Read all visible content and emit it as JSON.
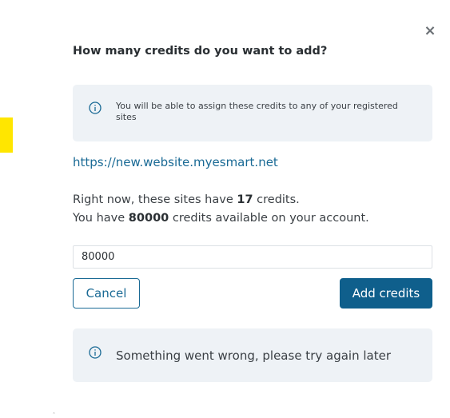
{
  "dialog": {
    "title": "How many credits do you want to add?",
    "close_icon": "close-icon",
    "close_glyph": "×"
  },
  "info_notice": {
    "icon": "info-icon",
    "text": "You will be able to assign these credits to any of your registered sites"
  },
  "site": {
    "url": "https://new.website.myesmart.net"
  },
  "summary": {
    "line1_prefix": "Right now, these sites have ",
    "site_credits": "17",
    "line1_suffix": " credits.",
    "line2_prefix": "You have ",
    "account_credits": "80000",
    "line2_suffix": " credits available on your account."
  },
  "credits_input": {
    "value": "80000"
  },
  "buttons": {
    "cancel_label": "Cancel",
    "add_label": "Add credits"
  },
  "error_notice": {
    "icon": "info-icon",
    "text": "Something went wrong, please try again later"
  },
  "colors": {
    "accent": "#0f5f8c",
    "link": "#1a6a95",
    "notice_bg": "#eef2f6",
    "marker": "#ffe600"
  }
}
